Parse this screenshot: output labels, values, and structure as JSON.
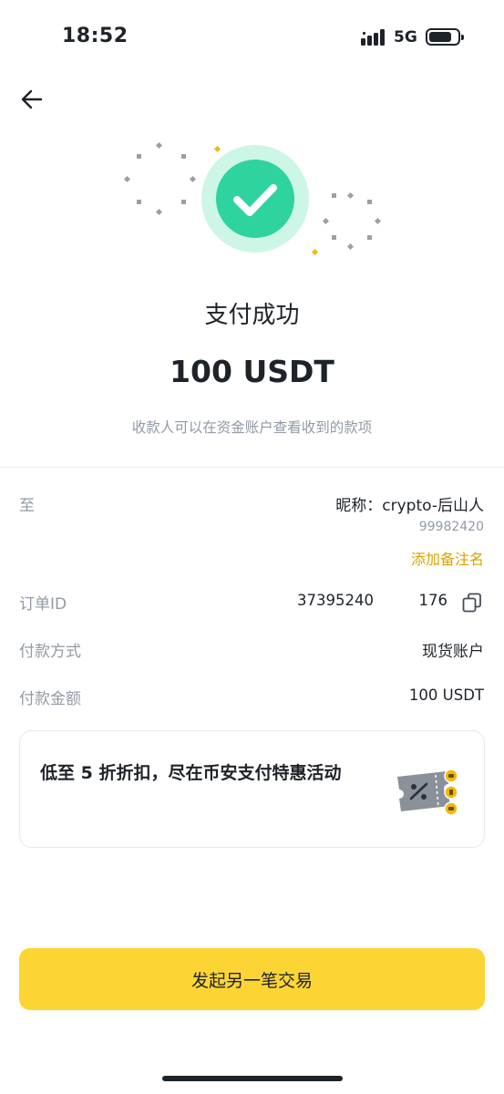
{
  "status_bar": {
    "time": "18:52",
    "network": "5G"
  },
  "result": {
    "title": "支付成功",
    "amount": "100 USDT",
    "subtitle": "收款人可以在资金账户查看收到的款项"
  },
  "details": {
    "to_label": "至",
    "nickname": "昵称：crypto-后山人",
    "uid": "99982420",
    "add_remark": "添加备注名",
    "order_label": "订单ID",
    "order_value": "37395240   176",
    "method_label": "付款方式",
    "method_value": "现货账户",
    "amount_label": "付款金额",
    "amount_value": "100 USDT"
  },
  "promo": {
    "text": "低至 5 折折扣，尽在币安支付特惠活动"
  },
  "actions": {
    "new_transaction": "发起另一笔交易"
  },
  "colors": {
    "brand_yellow": "#fcd535",
    "success_green": "#2ed3a0",
    "success_halo": "#cdf6e6",
    "link_gold": "#d9a203",
    "muted_text": "#929aa5"
  }
}
